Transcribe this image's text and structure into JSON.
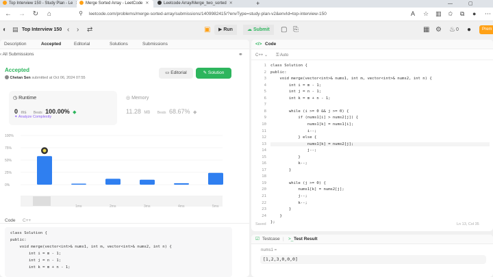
{
  "browser": {
    "tabs": [
      {
        "label": "Top Interview 150 - Study Plan - Le"
      },
      {
        "label": "Merge Sorted Array - LeetCode"
      },
      {
        "label": "Leetcode Array/Merge_two_sorted"
      }
    ],
    "url": "leetcode.com/problems/merge-sorted-array/submissions/1409982415/?envType=study-plan-v2&envId=top-interview-150"
  },
  "header": {
    "plan_title": "Top Interview 150",
    "run_label": "Run",
    "submit_label": "Submit",
    "premium_label": "Prem",
    "streak": "0"
  },
  "left_tabs": {
    "description": "Description",
    "accepted": "Accepted",
    "editorial": "Editorial",
    "solutions": "Solutions",
    "submissions": "Submissions"
  },
  "submission": {
    "back_label": "All Submissions",
    "status": "Accepted",
    "author": "Chetan Sen",
    "submitted_text": "submitted at Oct 06, 2024 07:55",
    "editorial_btn": "Editorial",
    "solution_btn": "Solution",
    "runtime_label": "Runtime",
    "runtime_value": "0",
    "runtime_unit": "ms",
    "beats_label": "Beats",
    "runtime_beats": "100.00%",
    "analyze_label": "Analyze Complexity",
    "memory_label": "Memory",
    "memory_value": "11.28",
    "memory_unit": "MB",
    "memory_beats": "68.67%"
  },
  "chart_data": {
    "type": "bar",
    "categories": [
      "0ms",
      "1ms",
      "2ms",
      "3ms",
      "4ms",
      "5ms"
    ],
    "values": [
      58,
      2,
      12,
      10,
      3,
      24
    ],
    "ylim": [
      0,
      100
    ],
    "yticks": [
      "100%",
      "75%",
      "50%",
      "25%",
      "0%"
    ],
    "color": "#2f7ff0",
    "highlight_index": 0
  },
  "left_code": {
    "header_label": "Code",
    "lang": "C++",
    "lines": [
      "class Solution {",
      "public:",
      "    void merge(vector<int>& nums1, int m, vector<int>& nums2, int n) {",
      "        int i = m - 1;",
      "        int j = n - 1;",
      "        int k = m + n - 1;"
    ]
  },
  "editor": {
    "tab_label": "Code",
    "lang": "C++",
    "auto_label": "Auto",
    "saved_label": "Saved",
    "cursor": "Ln 13, Col 35",
    "lines": [
      "class Solution {",
      "public:",
      "    void merge(vector<int>& nums1, int m, vector<int>& nums2, int n) {",
      "        int i = m - 1;",
      "        int j = n - 1;",
      "        int k = m + n - 1;",
      "",
      "        while (i >= 0 && j >= 0) {",
      "            if (nums1[i] > nums2[j]) {",
      "                nums1[k] = nums1[i];",
      "                i--;",
      "            } else {",
      "                nums1[k] = nums2[j];",
      "                j--;",
      "            }",
      "            k--;",
      "        }",
      "",
      "        while (j >= 0) {",
      "            nums1[k] = nums2[j];",
      "            j--;",
      "            k--;",
      "        }",
      "    }",
      "};"
    ],
    "line_numbers": [
      "1",
      "2",
      "3",
      "4",
      "5",
      "6",
      "7",
      "8",
      "9",
      "10",
      "11",
      "12",
      "13",
      "14",
      "15",
      "16",
      "17",
      "18",
      "19",
      "20",
      "21",
      "22",
      "23",
      "24"
    ]
  },
  "testcase": {
    "testcase_tab": "Testcase",
    "result_tab": "Test Result",
    "var_label": "nums1 =",
    "var_value": "[1,2,3,0,0,0]"
  }
}
